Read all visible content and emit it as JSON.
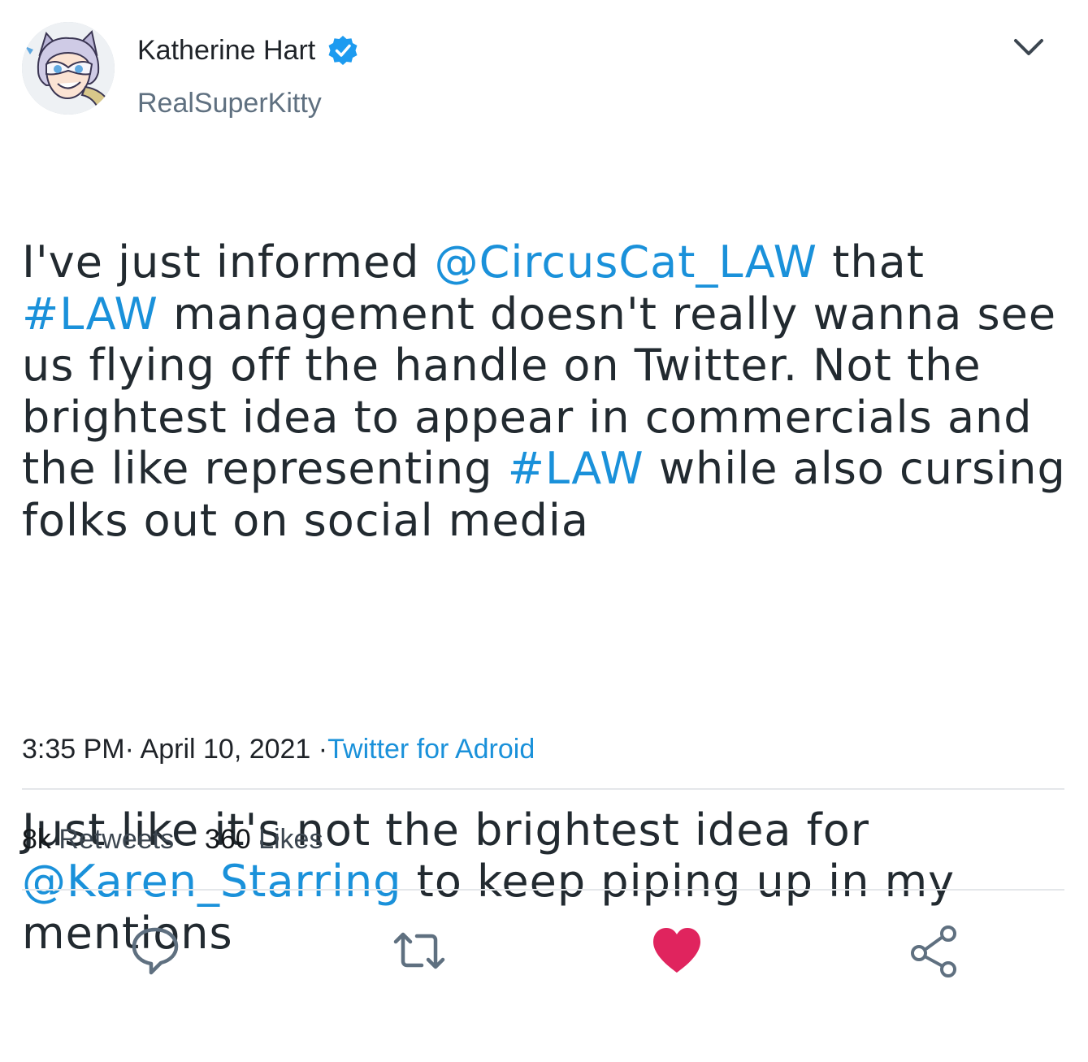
{
  "author": {
    "display_name": "Katherine Hart",
    "handle": "RealSuperKitty",
    "verified": true,
    "avatar_icon": "anime-cat-girl-avatar"
  },
  "tweet": {
    "paragraph1": {
      "t1": "I've just informed ",
      "m1": "@CircusCat_LAW",
      "t2": " that ",
      "h1": "#LAW",
      "t3": " management doesn't really wanna see us flying off the handle on Twitter. Not the brightest idea to appear in commercials and the like representing ",
      "h2": "#LAW",
      "t4": " while also cursing folks out on social media"
    },
    "paragraph2": {
      "t1": "Just like it's not the brightest idea for ",
      "m1": "@Karen_Starring",
      "t2": " to keep piping up in my mentions"
    },
    "time": "3:35 PM",
    "sep1": "·",
    "date": "April 10, 2021",
    "sep2": "·",
    "source": "Twitter for Adroid"
  },
  "stats": {
    "retweets_count": "8k",
    "retweets_label": "Retweets",
    "likes_count": "360",
    "likes_label": "Likes"
  },
  "colors": {
    "link": "#1a91da",
    "verified": "#1d9bf0",
    "like_active": "#e0245e",
    "icon_gray": "#5f7080"
  },
  "actions": [
    "reply-icon",
    "retweet-icon",
    "like-icon",
    "share-icon"
  ]
}
